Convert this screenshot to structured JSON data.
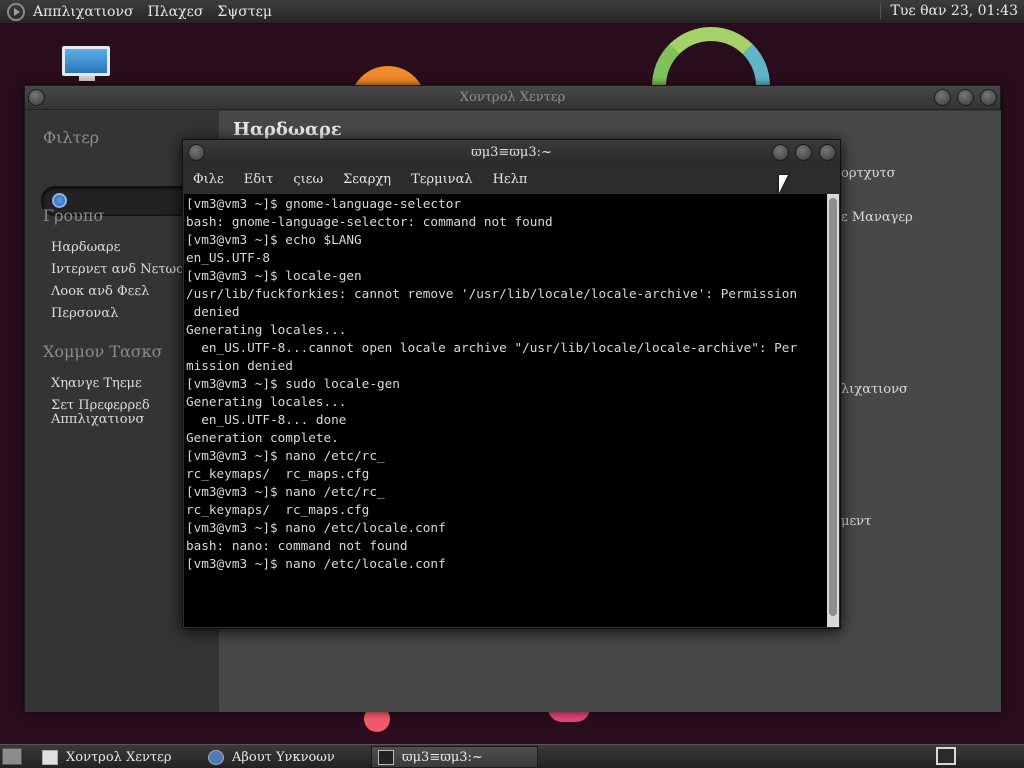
{
  "top_panel": {
    "menus": [
      "Αππλιχατιονσ",
      "Πλαχεσ",
      "Σψστεμ"
    ],
    "clock": "Τυε θαν 23, 01:43"
  },
  "control_center": {
    "title": "Χοντρολ Χεντερ",
    "filter_label": "Φιλτερ",
    "groups_label": "Γρουπσ",
    "groups": [
      "Ηαρδωαρε",
      "Ιντερνετ ανδ Νετωορκ",
      "Λοοκ ανδ Φεελ",
      "Περσοναλ"
    ],
    "common_tasks_label": "Χομμον Τασκσ",
    "common_tasks": [
      "Χηανγε Τηεμε",
      "Σετ Πρεφερρεδ Αππλιχατιονσ"
    ],
    "main_title": "Ηαρδωαρε",
    "main_items_visible": [
      "ορτχυτσ",
      "ε Μαναγερ",
      "λιχατιονσ",
      "μεντ"
    ]
  },
  "terminal": {
    "title": "ϖμ3≡ϖμ3:~",
    "menus": [
      "Φιλε",
      "Εδιτ",
      "ςιεω",
      "Σεαρχη",
      "Τερμιναλ",
      "Ηελπ"
    ],
    "lines": [
      "[vm3@vm3 ~]$ gnome-language-selector",
      "bash: gnome-language-selector: command not found",
      "[vm3@vm3 ~]$ echo $LANG",
      "en_US.UTF-8",
      "[vm3@vm3 ~]$ locale-gen",
      "/usr/lib/fuckforkies: cannot remove '/usr/lib/locale/locale-archive': Permission",
      " denied",
      "Generating locales...",
      "  en_US.UTF-8...cannot open locale archive \"/usr/lib/locale/locale-archive\": Per",
      "mission denied",
      "[vm3@vm3 ~]$ sudo locale-gen",
      "Generating locales...",
      "  en_US.UTF-8... done",
      "Generation complete.",
      "[vm3@vm3 ~]$ nano /etc/rc_",
      "rc_keymaps/  rc_maps.cfg",
      "[vm3@vm3 ~]$ nano /etc/rc_",
      "rc_keymaps/  rc_maps.cfg",
      "[vm3@vm3 ~]$ nano /etc/locale.conf",
      "bash: nano: command not found",
      "[vm3@vm3 ~]$ nano /etc/locale.conf"
    ]
  },
  "taskbar": {
    "tasks": [
      "Χοντρολ Χεντερ",
      "Αβουτ Υνκνοων",
      "ϖμ3≡ϖμ3:~"
    ],
    "active_task": "ϖμ3≡ϖμ3:~"
  },
  "colors": {
    "desktop_bg": "#2a0d1d",
    "terminal_bg": "#000000",
    "terminal_fg": "#d8d8d8"
  }
}
